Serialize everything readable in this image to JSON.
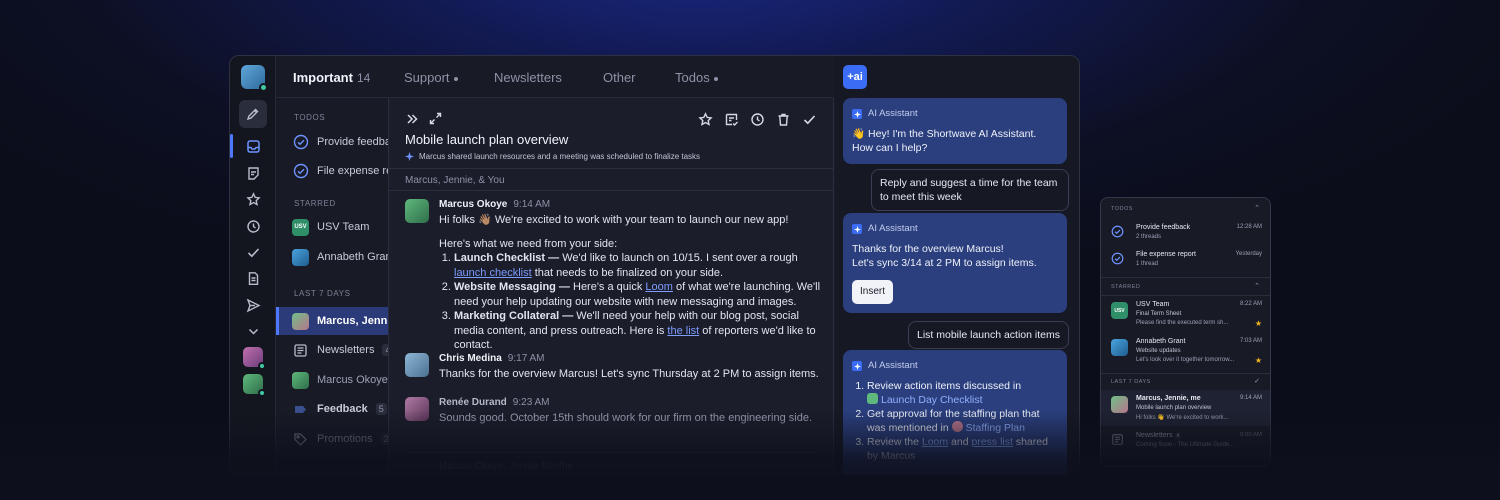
{
  "tabs": {
    "important": "Important",
    "important_count": "14",
    "support": "Support",
    "newsletters": "Newsletters",
    "other": "Other",
    "todos": "Todos"
  },
  "list": {
    "todos_header": "TODOS",
    "todo1": "Provide feedback",
    "todo2": "File expense report",
    "starred_header": "STARRED",
    "starred1": "USV Team",
    "starred2": "Annabeth Grant",
    "last7_header": "LAST 7 DAYS",
    "row_selected": "Marcus, Jennie, me",
    "row_newsletters": "Newsletters",
    "row_newsletters_count": "4",
    "row_marcus": "Marcus Okoye",
    "row_feedback": "Feedback",
    "row_feedback_count": "5",
    "row_promotions": "Promotions",
    "row_promotions_count": "2",
    "usv_badge": "USV"
  },
  "thread": {
    "title": "Mobile launch plan overview",
    "summary": "Marcus shared launch resources and a meeting was scheduled to finalize tasks",
    "participants": "Marcus, Jennie, & You",
    "bottom_hint": "Marcus Okoye, Jennie Boothe",
    "messages": {
      "m1": {
        "author": "Marcus Okoye",
        "time": "9:14 AM",
        "intro": "Hi folks 👋🏽 We're excited to work with your team to launch our new app!",
        "lead": "Here's what we need from your side:",
        "i1_bold": "Launch Checklist —",
        "i1_text": " We'd like to launch on 10/15. I sent over a rough ",
        "i1_link": "launch checklist",
        "i1_tail": " that needs to be finalized on your side.",
        "i2_bold": "Website Messaging —",
        "i2_text": " Here's a quick ",
        "i2_link": "Loom",
        "i2_tail": " of what we're launching. We'll need your help updating our website with new messaging and images.",
        "i3_bold": "Marketing Collateral —",
        "i3_text": " We'll need your help with our blog post, social media content, and press outreach. Here is ",
        "i3_link": "the list",
        "i3_tail": " of reporters we'd like to contact."
      },
      "m2": {
        "author": "Chris Medina",
        "time": "9:17 AM",
        "text": "Thanks for the overview Marcus! Let's sync Thursday at 2 PM to assign items."
      },
      "m3": {
        "author": "Renée Durand",
        "time": "9:23 AM",
        "text": "Sounds good. October 15th should work for our firm on the engineering side."
      }
    }
  },
  "ai": {
    "logo": "+ai",
    "assistant_label": "AI Assistant",
    "card1_line1": "👋 Hey! I'm the Shortwave AI Assistant.",
    "card1_line2": "How can I help?",
    "user1": "Reply and suggest a time for the team to meet this week",
    "card2_line1": "Thanks for the overview Marcus!",
    "card2_line2": "Let's sync 3/14 at 2 PM to assign items.",
    "insert_label": "Insert",
    "user2": "List mobile launch action items",
    "card3_i1": "Review action items discussed in",
    "card3_i1_link": "Launch Day Checklist",
    "card3_i2": "Get approval for the staffing plan that was mentioned in",
    "card3_i2_link": "Staffing Plan",
    "card3_i3a": "Review the ",
    "card3_i3_link1": "Loom",
    "card3_i3b": " and ",
    "card3_i3_link2": "press list",
    "card3_i3c": " shared by Marcus"
  },
  "mobile": {
    "todos": "TODOS",
    "t1_title": "Provide feedback",
    "t1_sub": "2 threads",
    "t1_time": "12:28 AM",
    "t2_title": "File expense report",
    "t2_sub": "1 thread",
    "t2_time": "Yesterday",
    "starred": "STARRED",
    "s1_title": "USV Team",
    "s1_sub": "Final Term Sheet",
    "s1_prev": "Please find the executed term sh...",
    "s1_time": "8:22 AM",
    "s2_title": "Annabeth Grant",
    "s2_sub": "Website updates",
    "s2_prev": "Let's look over it together tomorrow...",
    "s2_time": "7:03 AM",
    "last7": "LAST 7 DAYS",
    "l1_title": "Marcus, Jennie, me",
    "l1_sub": "Mobile launch plan overview",
    "l1_prev": "Hi folks 👋 We're excited to work...",
    "l1_time": "9:14 AM",
    "l2_title": "Newsletters",
    "l2_count": "4",
    "l2_prev": "Coming Soon - The Ultimate Guide...",
    "l2_time": "9:00 AM"
  }
}
